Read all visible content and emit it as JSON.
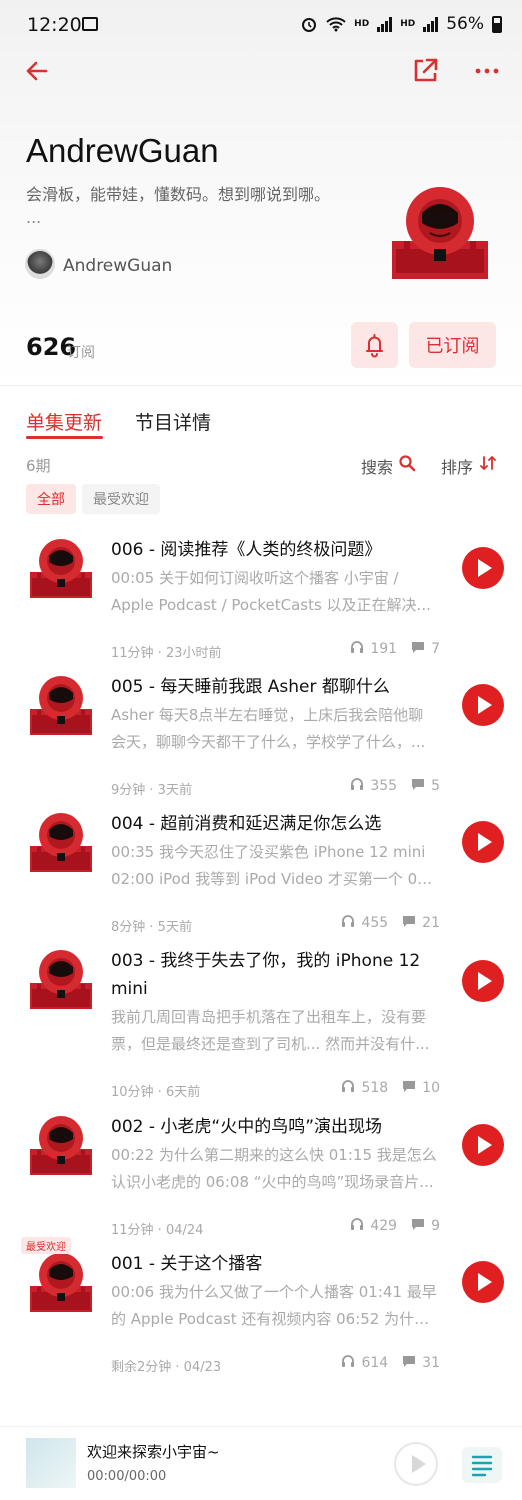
{
  "status_bar": {
    "time": "12:20",
    "network": "HD",
    "battery": "56%"
  },
  "header": {
    "title": "AndrewGuan",
    "description": "会滑板，能带娃，懂数码。想到哪说到哪。",
    "description_more": "...",
    "author": "AndrewGuan",
    "subscriber_count": "626",
    "subscriber_label": "订阅",
    "subscribe_button": "已订阅"
  },
  "tabs": [
    {
      "label": "单集更新",
      "active": true
    },
    {
      "label": "节目详情",
      "active": false
    }
  ],
  "toolbar": {
    "episode_count": "6期",
    "search": "搜索",
    "sort": "排序"
  },
  "filters": [
    {
      "label": "全部",
      "active": true
    },
    {
      "label": "最受欢迎",
      "active": false
    }
  ],
  "episodes": [
    {
      "title": "006 - 阅读推荐《人类的终极问题》",
      "desc_lines": [
        "00:05 关于如何订阅收听这个播客 小宇宙 /",
        "Apple Podcast / PocketCasts 以及正在解决..."
      ],
      "meta": "11分钟 · 23小时前",
      "plays": "191",
      "comments": "7"
    },
    {
      "title": "005 - 每天睡前我跟 Asher 都聊什么",
      "desc_lines": [
        "Asher 每天8点半左右睡觉，上床后我会陪他聊",
        "会天，聊聊今天都干了什么，学校学了什么，..."
      ],
      "meta": "9分钟 · 3天前",
      "plays": "355",
      "comments": "5"
    },
    {
      "title": "004 - 超前消费和延迟满足你怎么选",
      "desc_lines": [
        "00:35 我今天忍住了没买紫色 iPhone 12 mini",
        "02:00 iPod 我等到 iPod Video 才买第一个 03:..."
      ],
      "meta": "8分钟 · 5天前",
      "plays": "455",
      "comments": "21"
    },
    {
      "title": "003 - 我终于失去了你，我的 iPhone 12 mini",
      "desc_lines": [
        "我前几周回青岛把手机落在了出租车上，没有要",
        "票，但是最终还是查到了司机... 然而并没有什..."
      ],
      "meta": "10分钟 · 6天前",
      "plays": "518",
      "comments": "10"
    },
    {
      "title": "002 - 小老虎“火中的鸟鸣”演出现场",
      "desc_lines": [
        "00:22 为什么第二期来的这么快 01:15 我是怎么",
        "认识小老虎的 06:08 “火中的鸟鸣”现场录音片..."
      ],
      "meta": "11分钟 · 04/24",
      "plays": "429",
      "comments": "9"
    },
    {
      "title": "001 - 关于这个播客",
      "tag": "最受欢迎",
      "desc_lines": [
        "00:06 我为什么又做了一个个人播客 01:41 最早",
        "的 Apple Podcast 还有视频内容 06:52 为什么..."
      ],
      "meta": "剩余2分钟 · 04/23",
      "plays": "614",
      "comments": "31"
    }
  ],
  "player": {
    "title": "欢迎来探索小宇宙~",
    "time": "00:00/00:00"
  },
  "colors": {
    "accent": "#d93030",
    "play": "#e02020",
    "chip_bg": "#fde6e6"
  }
}
